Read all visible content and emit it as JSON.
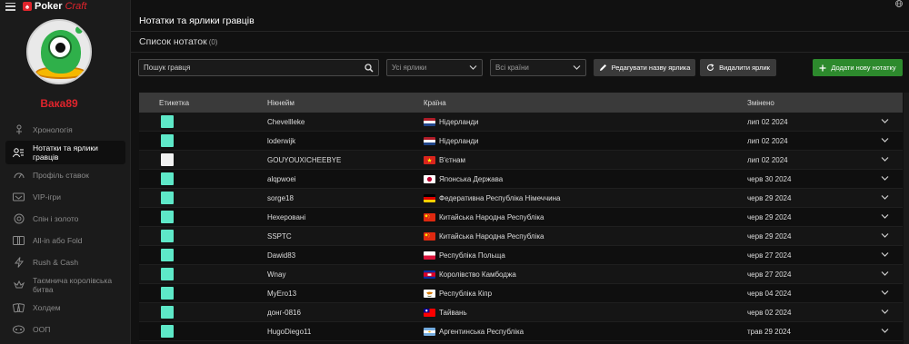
{
  "app": {
    "brand_poker": "Poker",
    "brand_craft": "Craft"
  },
  "sidebar": {
    "username": "Вака89",
    "items": [
      {
        "label": "Хронологія",
        "icon": "timeline-icon",
        "active": false
      },
      {
        "label": "Нотатки та ярлики гравців",
        "icon": "players-notes-icon",
        "active": true
      },
      {
        "label": "Профіль ставок",
        "icon": "gauge-icon",
        "active": false
      },
      {
        "label": "VIP-ігри",
        "icon": "vip-icon",
        "active": false
      },
      {
        "label": "Спін і золото",
        "icon": "spin-gold-icon",
        "active": false
      },
      {
        "label": "All-in або Fold",
        "icon": "all-in-icon",
        "active": false
      },
      {
        "label": "Rush & Cash",
        "icon": "rush-cash-icon",
        "active": false
      },
      {
        "label": "Таємнича королівська битва",
        "icon": "mystery-battle-icon",
        "active": false
      },
      {
        "label": "Холдем",
        "icon": "cards-icon",
        "active": false
      },
      {
        "label": "ООП",
        "icon": "oop-icon",
        "active": false
      }
    ]
  },
  "header": {
    "title": "Нотатки та ярлики гравців"
  },
  "subheader": {
    "title": "Список нотаток",
    "count": "(0)"
  },
  "toolbar": {
    "search_placeholder": "Пошук гравця",
    "labels_select": "Усі ярлики",
    "countries_select": "Всі країни",
    "edit_label": "Редагувати назву ярлика",
    "delete_label": "Видалити ярлик",
    "add_label": "Додати нову нотатку"
  },
  "table": {
    "columns": [
      "Етикетка",
      "Нікнейм",
      "Країна",
      "Змінено"
    ],
    "rows": [
      {
        "color": "#5ee8c8",
        "nick": "Chevellleke",
        "flag": "nl",
        "country": "Нідерланди",
        "date": "лип 02 2024"
      },
      {
        "color": "#5ee8c8",
        "nick": "loderwijk",
        "flag": "nl",
        "country": "Нідерланди",
        "date": "лип 02 2024"
      },
      {
        "color": "#f2f2f2",
        "nick": "GOUYOUXICHEEBYE",
        "flag": "vn",
        "country": "В'єтнам",
        "date": "лип 02 2024"
      },
      {
        "color": "#5ee8c8",
        "nick": "alqpwoei",
        "flag": "jp",
        "country": "Японська Держава",
        "date": "черв 30 2024"
      },
      {
        "color": "#5ee8c8",
        "nick": "sorge18",
        "flag": "de",
        "country": "Федеративна Республіка Німеччина",
        "date": "черв 29 2024"
      },
      {
        "color": "#5ee8c8",
        "nick": "Нехеровані",
        "flag": "cn",
        "country": "Китайська Народна Республіка",
        "date": "черв 29 2024"
      },
      {
        "color": "#5ee8c8",
        "nick": "SSPTC",
        "flag": "cn",
        "country": "Китайська Народна Республіка",
        "date": "черв 29 2024"
      },
      {
        "color": "#5ee8c8",
        "nick": "Dawid83",
        "flag": "pl",
        "country": "Республіка Польща",
        "date": "черв 27 2024"
      },
      {
        "color": "#5ee8c8",
        "nick": "Wnay",
        "flag": "kh",
        "country": "Королівство Камбоджа",
        "date": "черв 27 2024"
      },
      {
        "color": "#5ee8c8",
        "nick": "MyEro13",
        "flag": "cy",
        "country": "Республіка Кіпр",
        "date": "черв 04 2024"
      },
      {
        "color": "#5ee8c8",
        "nick": "донг-0816",
        "flag": "tw",
        "country": "Тайвань",
        "date": "черв 02 2024"
      },
      {
        "color": "#5ee8c8",
        "nick": "HugoDiego11",
        "flag": "ar",
        "country": "Аргентинська Республіка",
        "date": "трав 29 2024"
      }
    ]
  }
}
